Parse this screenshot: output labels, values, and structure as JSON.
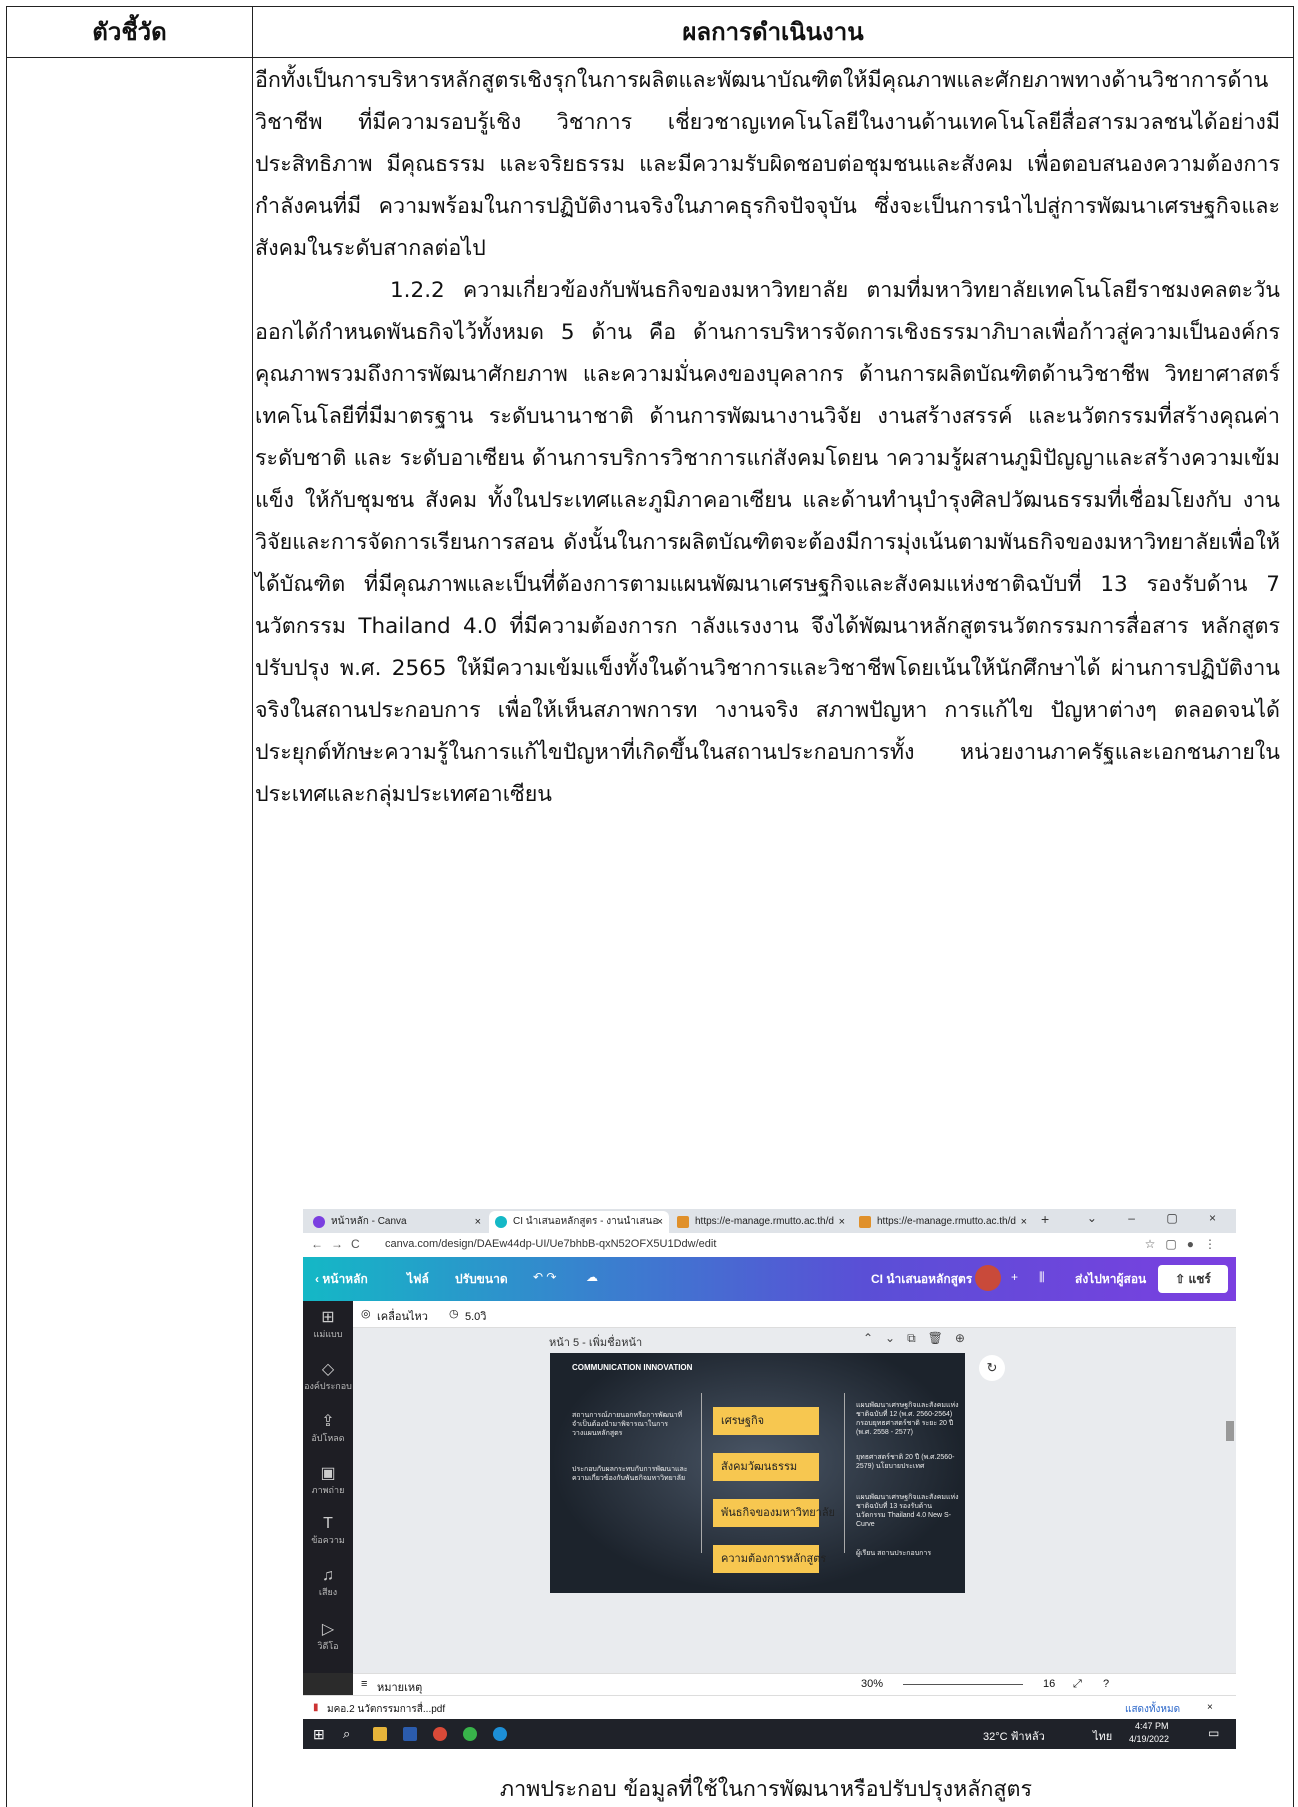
{
  "table": {
    "header_indicator": "ตัวชี้วัด",
    "header_result": "ผลการดำเนินงาน"
  },
  "paragraphs": [
    "อีกทั้งเป็นการบริหารหลักสูตรเชิงรุกในการผลิตและพัฒนาบัณฑิตให้มีคุณภาพและศักยภาพทางด้านวิชาการด้านวิชาชีพ ที่มีความรอบรู้เชิง วิชาการ เชี่ยวชาญเทคโนโลยีในงานด้านเทคโนโลยีสื่อสารมวลชนได้อย่างมีประสิทธิภาพ มีคุณธรรม และจริยธรรม และมีความรับผิดชอบต่อชุมชนและสังคม เพื่อตอบสนองความต้องการกำลังคนที่มี ความพร้อมในการปฏิบัติงานจริงในภาคธุรกิจปัจจุบัน ซึ่งจะเป็นการนำไปสู่การพัฒนาเศรษฐกิจและ สังคมในระดับสากลต่อไป",
    "1.2.2 ความเกี่ยวข้องกับพันธกิจของมหาวิทยาลัย ตามที่มหาวิทยาลัยเทคโนโลยีราชมงคลตะวันออกได้กำหนดพันธกิจไว้ทั้งหมด 5 ด้าน คือ ด้านการบริหารจัดการเชิงธรรมาภิบาลเพื่อก้าวสู่ความเป็นองค์กรคุณภาพรวมถึงการพัฒนาศักยภาพ และความมั่นคงของบุคลากร ด้านการผลิตบัณฑิตด้านวิชาชีพ วิทยาศาสตร์ เทคโนโลยีที่มีมาตรฐาน ระดับนานาชาติ ด้านการพัฒนางานวิจัย งานสร้างสรรค์ และนวัตกรรมที่สร้างคุณค่าระดับชาติ และ ระดับอาเซียน ด้านการบริการวิชาการแก่สังคมโดยน าความรู้ผสานภูมิปัญญาและสร้างความเข้มแข็ง ให้กับชุมชน สังคม ทั้งในประเทศและภูมิภาคอาเซียน และด้านทำนุบำรุงศิลปวัฒนธรรมที่เชื่อมโยงกับ งานวิจัยและการจัดการเรียนการสอน ดังนั้นในการผลิตบัณฑิตจะต้องมีการมุ่งเน้นตามพันธกิจของมหาวิทยาลัยเพื่อให้ได้บัณฑิต ที่มีคุณภาพและเป็นที่ต้องการตามแผนพัฒนาเศรษฐกิจและสังคมแห่งชาติฉบับที่ 13 รองรับด้าน 7 นวัตกรรม Thailand 4.0 ที่มีความต้องการก าลังแรงงาน จึงได้พัฒนาหลักสูตรนวัตกรรมการสื่อสาร หลักสูตรปรับปรุง พ.ศ. 2565 ให้มีความเข้มแข็งทั้งในด้านวิชาการและวิชาชีพโดยเน้นให้นักศึกษาได้ ผ่านการปฏิบัติงานจริงในสถานประกอบการ เพื่อให้เห็นสภาพการท างานจริง สภาพปัญหา การแก้ไข ปัญหาต่างๆ ตลอดจนได้ประยุกต์ทักษะความรู้ในการแก้ไขปัญหาที่เกิดขึ้นในสถานประกอบการทั้ง หน่วยงานภาครัฐและเอกชนภายในประเทศและกลุ่มประเทศอาเซียน"
  ],
  "screenshot": {
    "tabs": [
      {
        "title": "หน้าหลัก - Canva",
        "color": "#7b3fe0"
      },
      {
        "title": "CI นำเสนอหลักสูตร - งานนำเสนอ",
        "color": "#14b8c6"
      },
      {
        "title": "https://e-manage.rmutto.ac.th/d",
        "color": "#e0902a"
      },
      {
        "title": "https://e-manage.rmutto.ac.th/d",
        "color": "#e0902a"
      }
    ],
    "url": "canva.com/design/DAEw44dp-UI/Ue7bhbB-qxN52OFX5U1Ddw/edit",
    "toolbar": {
      "home": "‹ หน้าหลัก",
      "file": "ไฟล์",
      "resize": "ปรับขนาด",
      "doc_title": "CI นำเสนอหลักสูตร",
      "send_label": "ส่งไปหาผู้สอน",
      "share": "แชร์"
    },
    "sidebar": [
      "แม่แบบ",
      "องค์ประกอบ",
      "อัปโหลด",
      "ภาพถ่าย",
      "ข้อความ",
      "เสียง",
      "วิดีโอ"
    ],
    "subbar": {
      "animate": "เคลื่อนไหว",
      "duration": "5.0วิ"
    },
    "page_label": "หน้า 5 - เพิ่มชื่อหน้า",
    "slide": {
      "logo": "COMMUNICATION INNOVATION",
      "left_texts": [
        "สถานการณ์ภายนอกหรือการพัฒนาที่จำเป็นต้องนำมาพิจารณาในการวางแผนหลักสูตร",
        "ประกอบกับผลกระทบกับการพัฒนาและความเกี่ยวข้องกับพันธกิจมหาวิทยาลัย"
      ],
      "boxes": [
        "เศรษฐกิจ",
        "สังคมวัฒนธรรม",
        "พันธกิจของมหาวิทยาลัย",
        "ความต้องการหลักสูตร"
      ],
      "right_texts": [
        "แผนพัฒนาเศรษฐกิจและสังคมแห่งชาติฉบับที่ 12 (พ.ศ. 2560-2564) กรอบยุทธศาสตร์ชาติ ระยะ 20 ปี (พ.ศ. 2558 - 2577)",
        "ยุทธศาสตร์ชาติ 20 ปี (พ.ศ.2560-2579) นโยบายประเทศ",
        "แผนพัฒนาเศรษฐกิจและสังคมแห่งชาติฉบับที่ 13 รองรับด้านนวัตกรรม Thailand 4.0 New S-Curve",
        "ผู้เรียน สถานประกอบการ"
      ]
    },
    "bottom": {
      "notes": "หมายเหตุ",
      "zoom": "30%",
      "page": "16"
    },
    "download": {
      "file": "มคอ.2 นวัตกรรมการสื่...pdf",
      "show_all": "แสดงทั้งหมด"
    },
    "taskbar": {
      "weather": "32°C ฟ้าหลัว",
      "lang": "ไทย",
      "time": "4:47 PM",
      "date": "4/19/2022"
    }
  },
  "caption": "ภาพประกอบ ข้อมูลที่ใช้ในการพัฒนาหรือปรับปรุงหลักสูตร"
}
